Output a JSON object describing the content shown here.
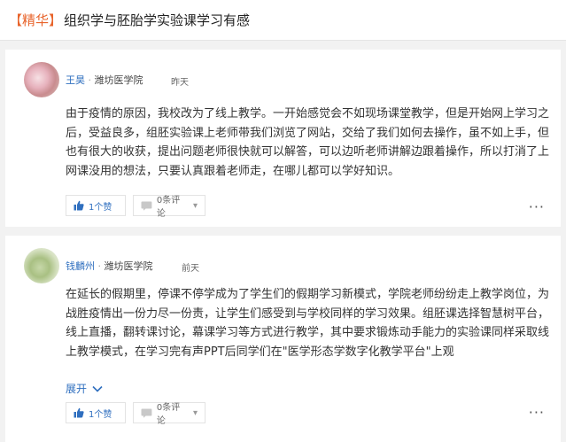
{
  "header": {
    "tag": "【精华】",
    "title": "组织学与胚胎学实验课学习有感"
  },
  "posts": [
    {
      "author": "王昊",
      "separator": "·",
      "school": "潍坊医学院",
      "time": "昨天",
      "content": "由于疫情的原因，我校改为了线上教学。一开始感觉会不如现场课堂教学，但是开始网上学习之后，受益良多，组胚实验课上老师带我们浏览了网站，交给了我们如何去操作，虽不如上手，但也有很大的收获，提出问题老师很快就可以解答，可以边听老师讲解边跟着操作，所以打消了上网课没用的想法，只要认真跟着老师走，在哪儿都可以学好知识。",
      "like_label": "1个赞",
      "comment_label": "0条评论",
      "more": "···"
    },
    {
      "author": "钱麟州",
      "separator": "·",
      "school": "潍坊医学院",
      "time": "前天",
      "content": "在延长的假期里，停课不停学成为了学生们的假期学习新模式，学院老师纷纷走上教学岗位，为战胜疫情出一份力尽一份责，让学生们感受到与学校同样的学习效果。组胚课选择智慧树平台，线上直播，翻转课讨论，幕课学习等方式进行教学，其中要求锻炼动手能力的实验课同样采取线上教学模式，在学习完有声PPT后同学们在\"医学形态学数字化教学平台\"上观",
      "expand_label": "展开",
      "like_label": "1个赞",
      "comment_label": "0条评论",
      "more": "···"
    }
  ],
  "colors": {
    "accent": "#2f6fbf",
    "tag": "#e8632a"
  },
  "icons": [
    "thumbs-up-icon",
    "comment-icon",
    "chevron-down-icon",
    "more-icon"
  ]
}
